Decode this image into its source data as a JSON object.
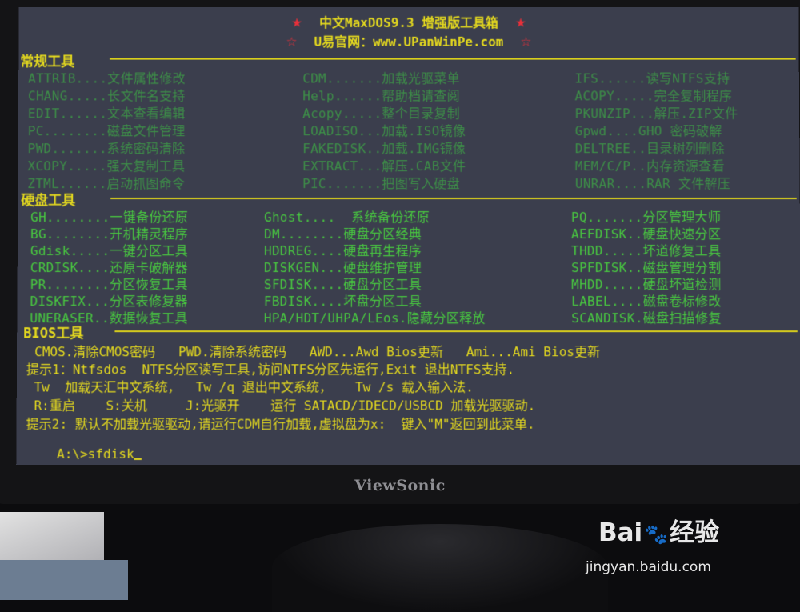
{
  "header": {
    "star": "★",
    "title": "中文MaxDOS9.3 增强版工具箱",
    "outline_star": "☆",
    "website": "U易官网：www.UPanWinPe.com"
  },
  "sections": {
    "general": {
      "title": "常规工具",
      "columns": [
        [
          "ATTRIB....文件属性修改",
          "CHANG.....长文件名支持",
          "EDIT......文本查看编辑",
          "PC........磁盘文件管理",
          "PWD.......系统密码清除",
          "XCOPY.....强大复制工具",
          "ZTML......启动抓图命令"
        ],
        [
          "CDM.......加载光驱菜单",
          "Help......帮助档请查阅",
          "Acopy.....整个目录复制",
          "LOADISO...加载.ISO镜像",
          "FAKEDISK..加载.IMG镜像",
          "EXTRACT...解压.CAB文件",
          "PIC.......把图写入硬盘"
        ],
        [
          "IFS......读写NTFS支持",
          "ACOPY.....完全复制程序",
          "PKUNZIP...解压.ZIP文件",
          "Gpwd....GHO 密码破解",
          "DELTREE..目录树列删除",
          "MEM/C/P..内存资源查看",
          "UNRAR....RAR 文件解压"
        ]
      ]
    },
    "disk": {
      "title": "硬盘工具",
      "columns": [
        [
          "GH........一键备份还原",
          "BG........开机精灵程序",
          "Gdisk.....一键分区工具",
          "CRDISK....还原卡破解器",
          "PR........分区恢复工具",
          "DISKFIX...分区表修复器",
          "UNERASER..数据恢复工具"
        ],
        [
          "Ghost....  系统备份还原",
          "DM........硬盘分区经典",
          "HDDREG....硬盘再生程序",
          "DISKGEN...硬盘维护管理",
          "SFDISK....硬盘分区工具",
          "FBDISK....坏盘分区工具",
          "HPA/HDT/UHPA/LEos.隐藏分区释放"
        ],
        [
          "PQ.......分区管理大师",
          "AEFDISK..硬盘快速分区",
          "THDD.....坏道修复工具",
          "SPFDISK..磁盘管理分割",
          "MHDD.....硬盘坏道检测",
          "LABEL....磁盘卷标修改",
          "SCANDISK.磁盘扫描修复"
        ]
      ]
    },
    "bios": {
      "title": "BIOS工具",
      "line": "CMOS.清除CMOS密码   PWD.清除系统密码   AWD...Awd Bios更新   Ami...Ami Bios更新"
    }
  },
  "tips": {
    "tip1": "提示1：Ntfsdos  NTFS分区读写工具,访问NTFS分区先运行,Exit 退出NTFS支持.",
    "tip1_tw": " Tw  加载天汇中文系统，  Tw /q 退出中文系统，   Tw /s 载入输入法.",
    "tip1_keys": " R:重启    S:关机     J:光驱开    运行 SATACD/IDECD/USBCD 加载光驱驱动.",
    "tip2": "提示2: 默认不加载光驱驱动,请运行CDM自行加载,虚拟盘为x:  键入\"M\"返回到此菜单."
  },
  "prompt": {
    "path": "A:\\>",
    "command": "sfdisk"
  },
  "monitor": {
    "brand": "ViewSonic"
  },
  "watermark": {
    "logo_left": "Bai",
    "paw": "🐾",
    "logo_right": "经验",
    "url": "jingyan.baidu.com"
  }
}
